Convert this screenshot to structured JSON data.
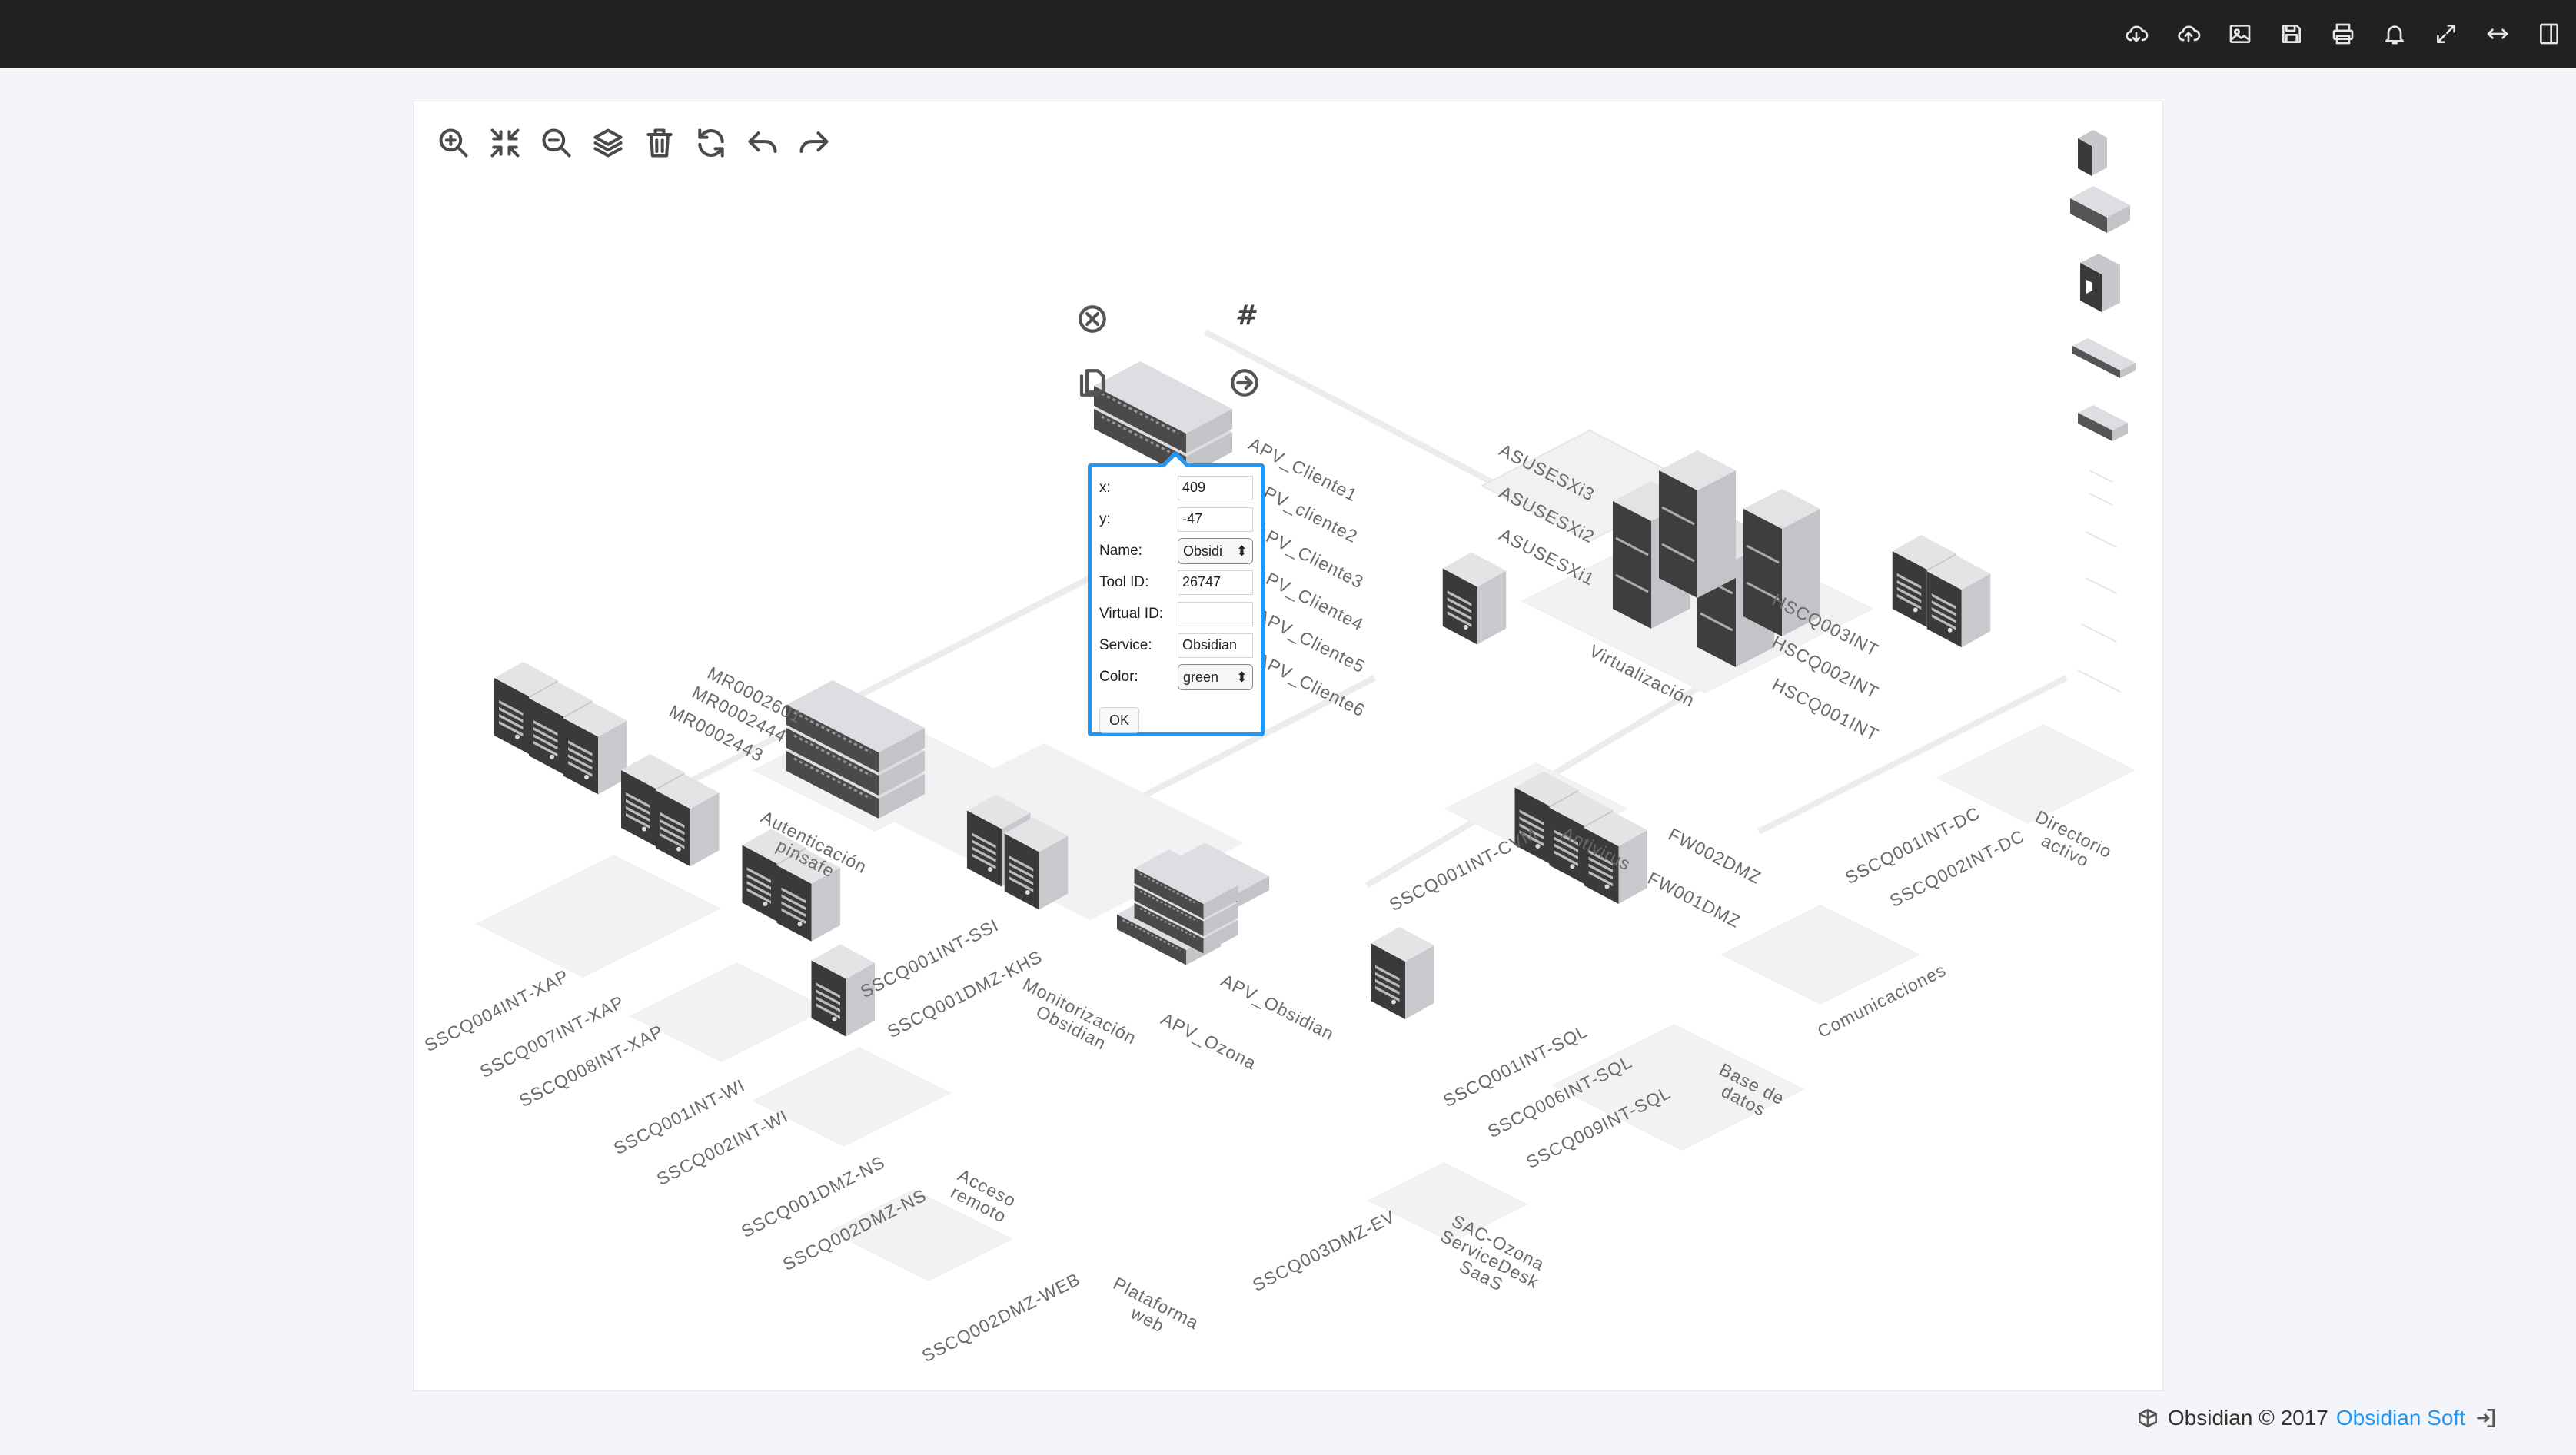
{
  "topbar": {
    "icons": [
      "download-cloud-icon",
      "upload-cloud-icon",
      "image-icon",
      "save-icon",
      "print-icon",
      "bell-icon",
      "expand-icon",
      "fit-width-icon",
      "sidebar-icon"
    ]
  },
  "toolbar": {
    "tools": [
      "zoom-in-icon",
      "fit-icon",
      "zoom-out-icon",
      "layers-icon",
      "trash-icon",
      "refresh-icon",
      "undo-icon",
      "redo-icon"
    ]
  },
  "palette": {
    "items": [
      "tower-server",
      "rack-server",
      "firewall",
      "switch",
      "router"
    ]
  },
  "context_menu": {
    "hash_label": "#"
  },
  "popup": {
    "x_label": "x:",
    "x_value": "409",
    "y_label": "y:",
    "y_value": "-47",
    "name_label": "Name:",
    "name_value": "Obsidi",
    "toolid_label": "Tool ID:",
    "toolid_value": "26747",
    "virtualid_label": "Virtual ID:",
    "virtualid_value": "",
    "service_label": "Service:",
    "service_value": "Obsidian",
    "color_label": "Color:",
    "color_value": "green",
    "ok_label": "OK"
  },
  "diagram": {
    "apv_labels": [
      "APV_Cliente1",
      "APV_cliente2",
      "APV_Cliente3",
      "APV_Cliente4",
      "APV_Cliente5",
      "APV_Cliente6"
    ],
    "auth_labels": [
      "MR0002601",
      "MR0002444",
      "MR0002443"
    ],
    "auth_group": "Autenticación\npinsafe",
    "virt_left_labels": [
      "ASUSESXi3",
      "ASUSESXi2",
      "ASUSESXi1"
    ],
    "virt_right_labels": [
      "HSCQ003INT",
      "HSCQ002INT",
      "HSCQ001INT"
    ],
    "virt_group": "Virtualización",
    "antivirus_label": "SSCQ001INT-CVM",
    "antivirus_group": "Antivirus",
    "dc_labels": [
      "SSCQ001INT-DC",
      "SSCQ002INT-DC"
    ],
    "dc_group": "Directorio\nactivo",
    "fw_labels": [
      "FW002DMZ",
      "FW001DMZ"
    ],
    "fw_group": "Comunicaciones",
    "monitor_labels": [
      "SSCQ001INT-SSI",
      "SSCQ001DMZ-KHS"
    ],
    "monitor_group": "Monitorización\nObsidian",
    "apv_ozona": "APV_Ozona",
    "apv_obsidian": "APV_Obsidian",
    "xap_labels": [
      "SSCQ004INT-XAP",
      "SSCQ007INT-XAP",
      "SSCQ008INT-XAP"
    ],
    "wi_labels": [
      "SSCQ001INT-WI",
      "SSCQ002INT-WI"
    ],
    "ns_labels": [
      "SSCQ001DMZ-NS",
      "SSCQ002DMZ-NS"
    ],
    "ns_group": "Acceso\nremoto",
    "web_label": "SSCQ002DMZ-WEB",
    "web_group": "Plataforma\nweb",
    "sql_labels": [
      "SSCQ001INT-SQL",
      "SSCQ006INT-SQL",
      "SSCQ009INT-SQL"
    ],
    "sql_group": "Base de\ndatos",
    "ev_label": "SSCQ003DMZ-EV",
    "ev_group": "SAC-Ozona\nServiceDesk\nSaaS"
  },
  "footer": {
    "text": "Obsidian © 2017",
    "link": "Obsidian Soft"
  }
}
